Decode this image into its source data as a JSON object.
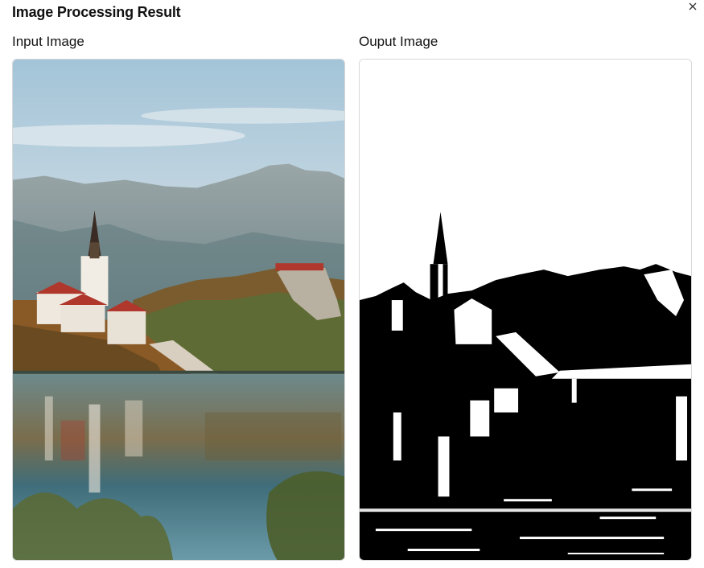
{
  "dialog": {
    "title": "Image Processing Result",
    "close_icon": "close-icon"
  },
  "panels": {
    "input": {
      "label": "Input Image"
    },
    "output": {
      "label": "Ouput Image"
    }
  },
  "colors": {
    "sky_top": "#a9c9da",
    "sky_bottom": "#d8e3e8",
    "mountain": "#8a9aa0",
    "foliage": "#8a6a35",
    "water": "#4e7f8a",
    "roof": "#b0372b",
    "ink": "#000000",
    "paper": "#ffffff"
  }
}
